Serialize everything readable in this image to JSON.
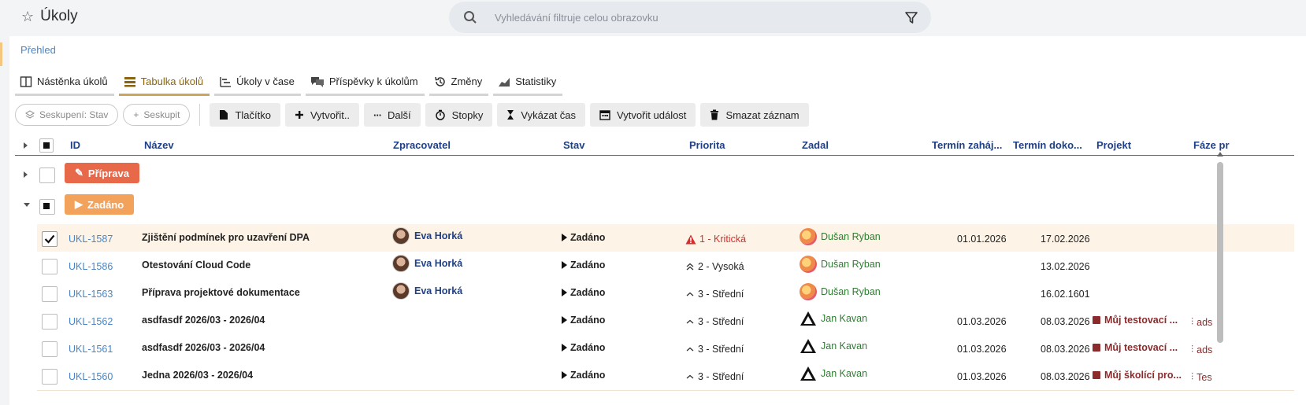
{
  "app": {
    "title": "Úkoly"
  },
  "search": {
    "placeholder": "Vyhledávání filtruje celou obrazovku"
  },
  "breadcrumb": "Přehled",
  "tabs": [
    {
      "label": "Nástěnka úkolů",
      "icon": "board-icon"
    },
    {
      "label": "Tabulka úkolů",
      "icon": "list-icon",
      "active": true
    },
    {
      "label": "Úkoly v čase",
      "icon": "timeline-icon"
    },
    {
      "label": "Příspěvky k úkolům",
      "icon": "comments-icon"
    },
    {
      "label": "Změny",
      "icon": "history-icon"
    },
    {
      "label": "Statistiky",
      "icon": "chart-icon"
    }
  ],
  "toolbar": {
    "grouping_label": "Seskupení: Stav",
    "group_label": "Seskupit",
    "buttons": [
      "Tlačítko",
      "Vytvořit..",
      "Další",
      "Stopky",
      "Vykázat čas",
      "Vytvořit událost",
      "Smazat záznam"
    ]
  },
  "columns": {
    "id": "ID",
    "name": "Název",
    "assignee": "Zpracovatel",
    "state": "Stav",
    "priority": "Priorita",
    "reporter": "Zadal",
    "start": "Termín zaháj...",
    "due": "Termín doko...",
    "project": "Projekt",
    "phase": "Fáze pr"
  },
  "groups": [
    {
      "label": "Příprava",
      "color": "#e8694a"
    },
    {
      "label": "Zadáno",
      "color": "#f3a25b"
    }
  ],
  "rows": [
    {
      "id": "UKL-1587",
      "name": "Zjištění podmínek pro uzavření DPA",
      "assignee": "Eva Horká",
      "state": "Zadáno",
      "priority": "1 - Kritická",
      "reporter": "Dušan Ryban",
      "start": "01.01.2026",
      "due": "17.02.2026",
      "project": "",
      "phase": "",
      "checked": true
    },
    {
      "id": "UKL-1586",
      "name": "Otestování Cloud Code",
      "assignee": "Eva Horká",
      "state": "Zadáno",
      "priority": "2 - Vysoká",
      "reporter": "Dušan Ryban",
      "start": "",
      "due": "13.02.2026",
      "project": "",
      "phase": ""
    },
    {
      "id": "UKL-1563",
      "name": "Příprava projektové dokumentace",
      "assignee": "Eva Horká",
      "state": "Zadáno",
      "priority": "3 - Střední",
      "reporter": "Dušan Ryban",
      "start": "",
      "due": "16.02.1601",
      "project": "",
      "phase": ""
    },
    {
      "id": "UKL-1562",
      "name": "asdfasdf 2026/03 - 2026/04",
      "assignee": "",
      "state": "Zadáno",
      "priority": "3 - Střední",
      "reporter": "Jan Kavan",
      "start": "01.03.2026",
      "due": "08.03.2026",
      "project": "Můj testovací ...",
      "phase": "ads"
    },
    {
      "id": "UKL-1561",
      "name": "asdfasdf 2026/03 - 2026/04",
      "assignee": "",
      "state": "Zadáno",
      "priority": "3 - Střední",
      "reporter": "Jan Kavan",
      "start": "01.03.2026",
      "due": "08.03.2026",
      "project": "Můj testovací ...",
      "phase": "ads"
    },
    {
      "id": "UKL-1560",
      "name": "Jedna 2026/03 - 2026/04",
      "assignee": "",
      "state": "Zadáno",
      "priority": "3 - Střední",
      "reporter": "Jan Kavan",
      "start": "01.03.2026",
      "due": "08.03.2026",
      "project": "Můj školící pro...",
      "phase": "Tes"
    }
  ],
  "colors": {
    "accent": "#caa55a",
    "header_text": "#1f3f86",
    "link": "#4a86c5",
    "critical": "#d32f2f",
    "reporter": "#2e7d32",
    "project": "#8b2b2b"
  }
}
